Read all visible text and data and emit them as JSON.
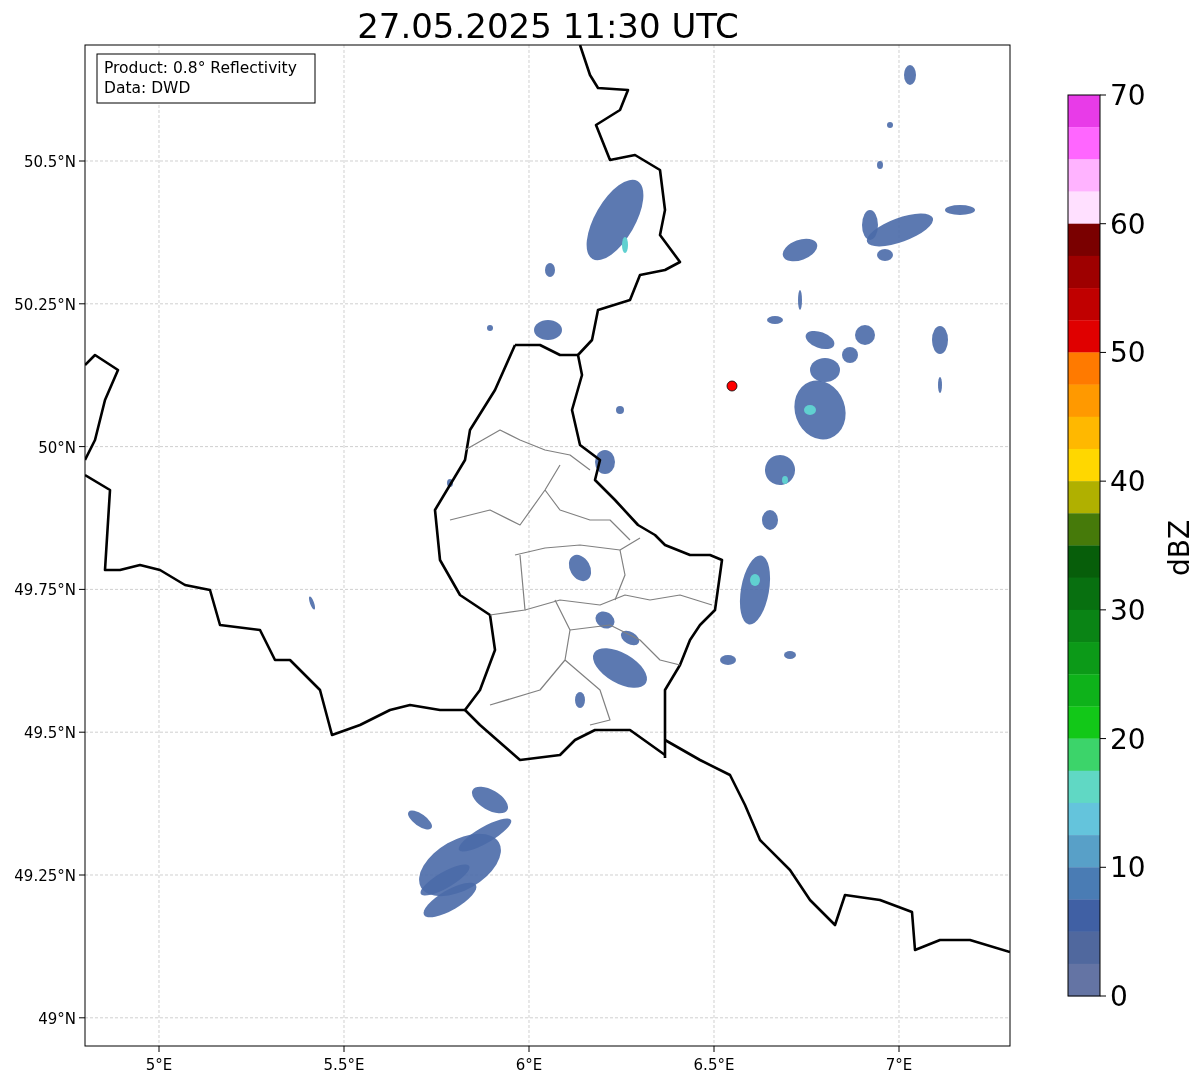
{
  "title": "27.05.2025 11:30 UTC",
  "info_box": {
    "lines": [
      "Product: 0.8° Reflectivity",
      "Data: DWD"
    ]
  },
  "map": {
    "x_ticks": [
      "5°E",
      "5.5°E",
      "6°E",
      "6.5°E",
      "7°E"
    ],
    "y_ticks": [
      "50.5°N",
      "50.25°N",
      "50°N",
      "49.75°N",
      "49.5°N",
      "49.25°N",
      "49°N"
    ]
  },
  "colorbar": {
    "label": "dBZ",
    "ticks": [
      "70",
      "60",
      "50",
      "40",
      "30",
      "20",
      "10",
      "0"
    ],
    "bands": [
      {
        "color": "#e83be8"
      },
      {
        "color": "#ff66ff"
      },
      {
        "color": "#ffb3ff"
      },
      {
        "color": "#ffe0ff"
      },
      {
        "color": "#7a0000"
      },
      {
        "color": "#9e0000"
      },
      {
        "color": "#c00000"
      },
      {
        "color": "#e00000"
      },
      {
        "color": "#ff7a00"
      },
      {
        "color": "#ff9900"
      },
      {
        "color": "#ffb800"
      },
      {
        "color": "#ffd700"
      },
      {
        "color": "#b0b000"
      },
      {
        "color": "#467a0a"
      },
      {
        "color": "#075e0a"
      },
      {
        "color": "#087010"
      },
      {
        "color": "#0a8415"
      },
      {
        "color": "#0c9a18"
      },
      {
        "color": "#0eb21a"
      },
      {
        "color": "#12c818"
      },
      {
        "color": "#3cd46a"
      },
      {
        "color": "#60d8c4"
      },
      {
        "color": "#64c4dc"
      },
      {
        "color": "#58a0c8"
      },
      {
        "color": "#4a7cb4"
      },
      {
        "color": "#4060a4"
      },
      {
        "color": "#50689e"
      },
      {
        "color": "#6474a4"
      }
    ]
  }
}
